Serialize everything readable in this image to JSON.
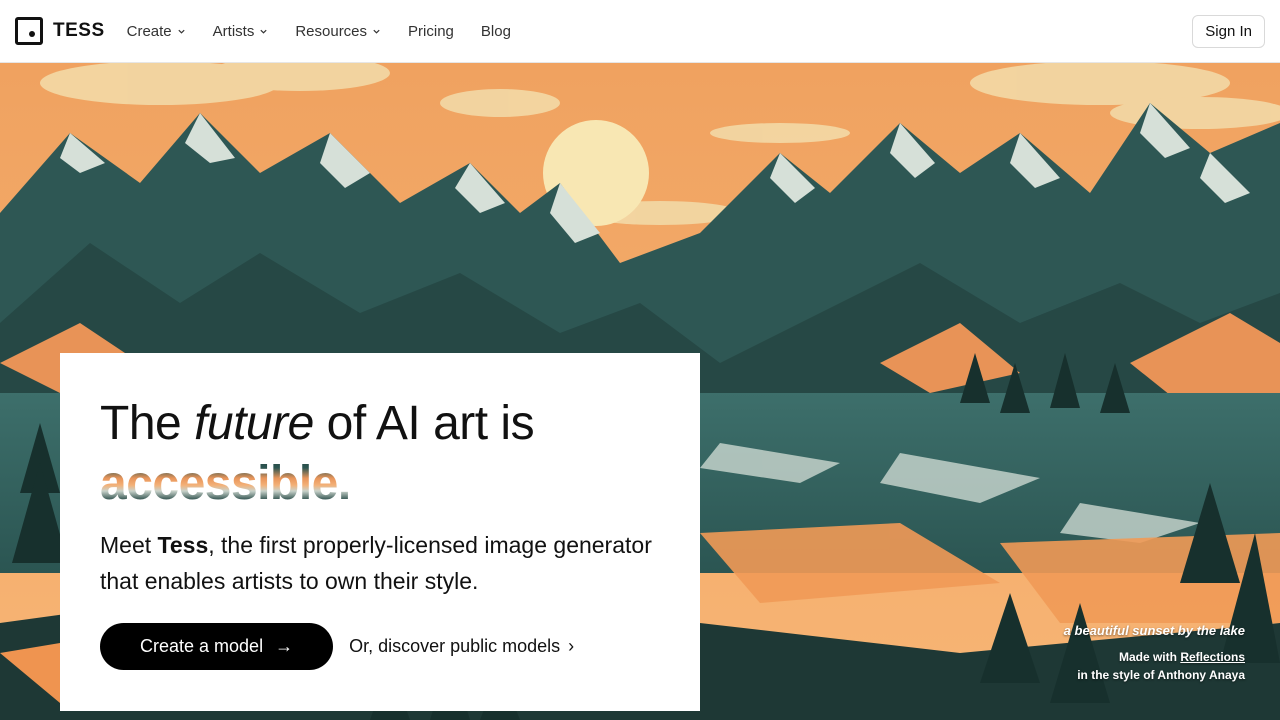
{
  "brand": {
    "name": "TESS"
  },
  "nav": {
    "items": [
      {
        "label": "Create",
        "has_menu": true
      },
      {
        "label": "Artists",
        "has_menu": true
      },
      {
        "label": "Resources",
        "has_menu": true
      },
      {
        "label": "Pricing",
        "has_menu": false
      },
      {
        "label": "Blog",
        "has_menu": false
      }
    ],
    "signin_label": "Sign In"
  },
  "hero": {
    "headline_start": "The",
    "headline_italic": "future",
    "headline_end": "of AI art is",
    "headline_accent": "accessible.",
    "sub_start": "Meet",
    "sub_brand": "Tess",
    "sub_end": ", the first properly-licensed image generator that enables artists to own their style.",
    "cta_label": "Create a model",
    "secondary_label": "Or, discover public models"
  },
  "caption": {
    "prompt": "a beautiful sunset by the lake",
    "made_with_prefix": "Made with",
    "model_name": "Reflections",
    "style_line": "in the style of Anthony Anaya"
  },
  "colors": {
    "sky_orange": "#f29a55",
    "mountain_teal": "#2f5c5a",
    "snow": "#d9e2da",
    "sun": "#f7e7b2",
    "cta_bg": "#000000"
  }
}
